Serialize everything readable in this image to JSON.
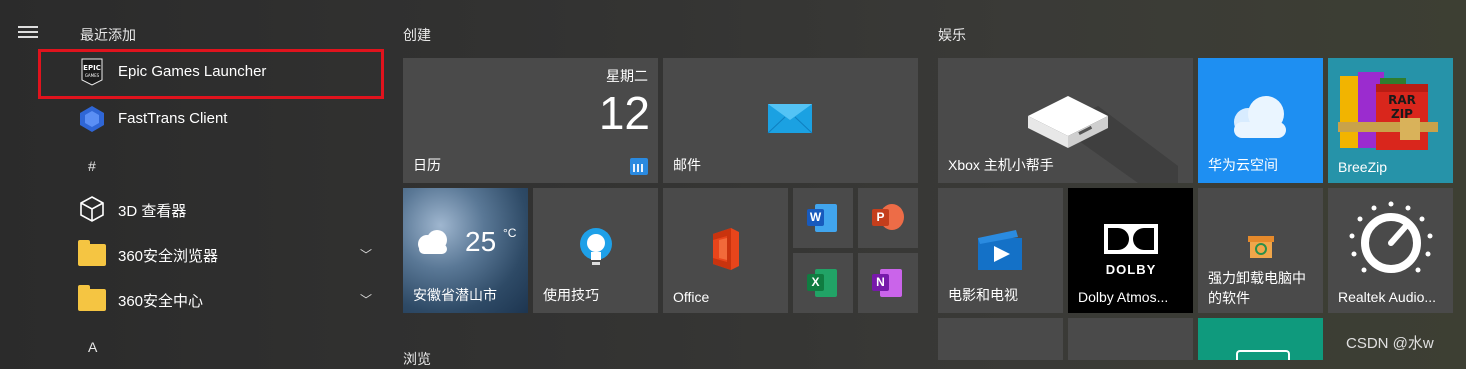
{
  "applist": {
    "recent_header": "最近添加",
    "items": [
      {
        "label": "Epic Games Launcher"
      },
      {
        "label": "FastTrans Client"
      }
    ],
    "hash_header": "#",
    "items2": [
      {
        "label": "3D 查看器"
      },
      {
        "label": "360安全浏览器"
      },
      {
        "label": "360安全中心"
      }
    ],
    "a_header": "A"
  },
  "groups": {
    "create": "创建",
    "entertainment": "娱乐",
    "browse": "浏览"
  },
  "tiles": {
    "calendar": {
      "label": "日历",
      "weekday": "星期二",
      "day": "12"
    },
    "mail": {
      "label": "邮件"
    },
    "weather": {
      "label": "安徽省潜山市",
      "temp": "25",
      "unit": "°C"
    },
    "tips": {
      "label": "使用技巧"
    },
    "office": {
      "label": "Office"
    },
    "word_letter": "W",
    "ppt_letter": "P",
    "excel_letter": "X",
    "onenote_letter": "N",
    "xbox": {
      "label": "Xbox 主机小帮手"
    },
    "huawei": {
      "label": "华为云空间"
    },
    "breezip": {
      "label": "BreeZip",
      "logo_text_1": "RAR",
      "logo_text_2": "ZIP"
    },
    "movies": {
      "label": "电影和电视"
    },
    "dolby": {
      "label": "Dolby Atmos...",
      "logo_text": "DOLBY"
    },
    "uninstall": {
      "label_line1": "强力卸载电脑中",
      "label_line2": "的软件"
    },
    "realtek": {
      "label": "Realtek Audio..."
    }
  },
  "watermark": "CSDN @水w",
  "colors": {
    "highlight_red": "#e0131d",
    "huawei_blue": "#1e8ff2",
    "breezip_teal": "#2693a9",
    "dolby_black": "#000000",
    "teal_bottom": "#0f9a7d"
  }
}
